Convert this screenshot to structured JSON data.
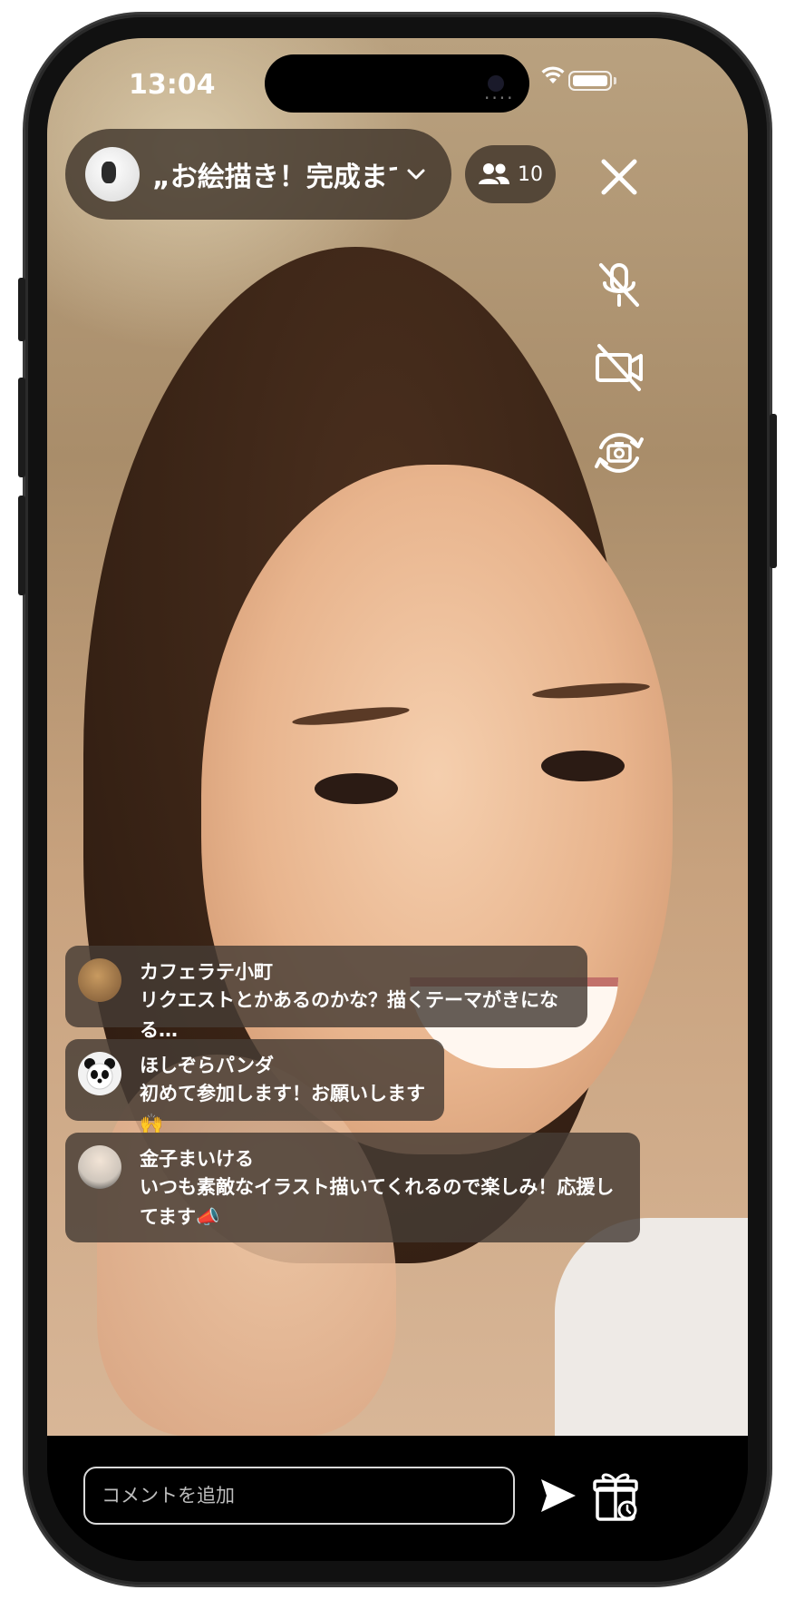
{
  "status_bar": {
    "time": "13:04",
    "signal_dots": "....",
    "icons": [
      "wifi-icon",
      "battery-icon"
    ]
  },
  "header": {
    "stream_title": "„お絵描き！完成まで”",
    "chevron_icon": "chevron-down-icon",
    "viewer_count": "10",
    "viewer_icon": "people-icon"
  },
  "controls": [
    {
      "name": "close-icon",
      "label": "close"
    },
    {
      "name": "mic-off-icon",
      "label": "microphone off"
    },
    {
      "name": "video-off-icon",
      "label": "camera off"
    },
    {
      "name": "switch-camera-icon",
      "label": "switch camera"
    }
  ],
  "comments": [
    {
      "user": "カフェラテ小町",
      "text": "リクエストとかあるのかな？描くテーマがきになる…",
      "avatar_color": "#8a6a45"
    },
    {
      "user": "ほしぞらパンダ",
      "text": "初めて参加します！お願いします🙌",
      "avatar_color": "#f2f2f2"
    },
    {
      "user": "金子まいける",
      "text": "いつも素敵なイラスト描いてくれるので楽しみ！応援してます📣",
      "avatar_color": "#d6d0c8"
    }
  ],
  "footer": {
    "input_placeholder": "コメントを追加",
    "send_icon": "send-icon",
    "gift_icon": "gift-icon"
  },
  "colors": {
    "overlay": "#3a3026",
    "text": "#ffffff",
    "bar": "#000000"
  }
}
